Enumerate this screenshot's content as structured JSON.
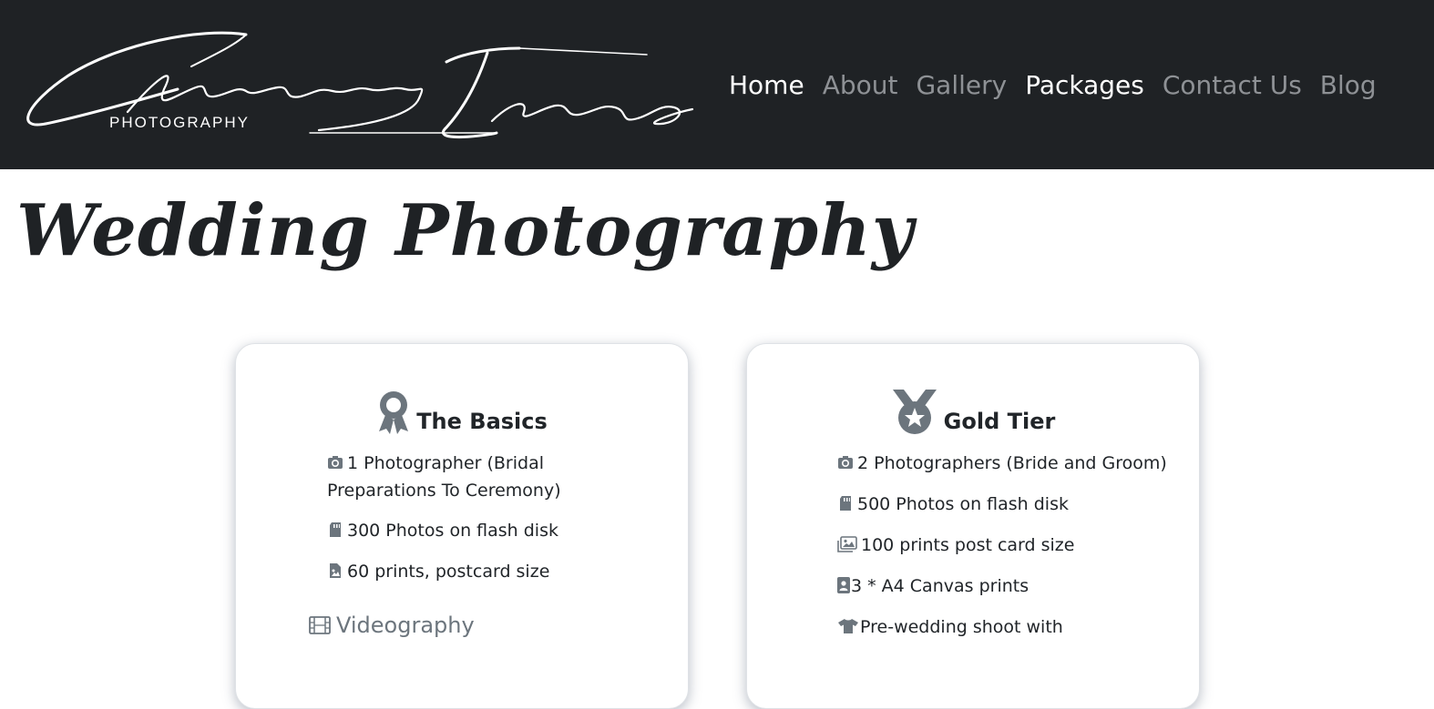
{
  "logo": {
    "script_text": "Charming Images",
    "sub_text": "PHOTOGRAPHY"
  },
  "nav": [
    {
      "label": "Home",
      "active": true
    },
    {
      "label": "About",
      "active": false
    },
    {
      "label": "Gallery",
      "active": false
    },
    {
      "label": "Packages",
      "active": true
    },
    {
      "label": "Contact Us",
      "active": false
    },
    {
      "label": "Blog",
      "active": false
    }
  ],
  "page_title": "Wedding Photography",
  "cards": [
    {
      "icon": "award-ribbon-icon",
      "title": "The Basics",
      "features": [
        {
          "icon": "camera-icon",
          "text": "1 Photographer (Bridal Preparations To Ceremony)"
        },
        {
          "icon": "sd-card-icon",
          "text": "300 Photos on flash disk"
        },
        {
          "icon": "file-image-icon",
          "text": "60 prints, postcard size"
        }
      ],
      "subheading": {
        "icon": "film-icon",
        "text": "Videography"
      }
    },
    {
      "icon": "medal-star-icon",
      "title": "Gold Tier",
      "features": [
        {
          "icon": "camera-icon",
          "text": "2 Photographers (Bride and Groom)"
        },
        {
          "icon": "sd-card-icon",
          "text": "500 Photos on flash disk"
        },
        {
          "icon": "images-icon",
          "text": "100 prints post card size"
        },
        {
          "icon": "portrait-icon",
          "text": "3 * A4 Canvas prints"
        },
        {
          "icon": "tshirt-icon",
          "text": "Pre-wedding shoot with"
        }
      ]
    }
  ],
  "colors": {
    "navbar_bg": "#1f2225",
    "nav_active": "#ffffff",
    "nav_inactive": "#8e9195",
    "icon_gray": "#6c757d"
  }
}
